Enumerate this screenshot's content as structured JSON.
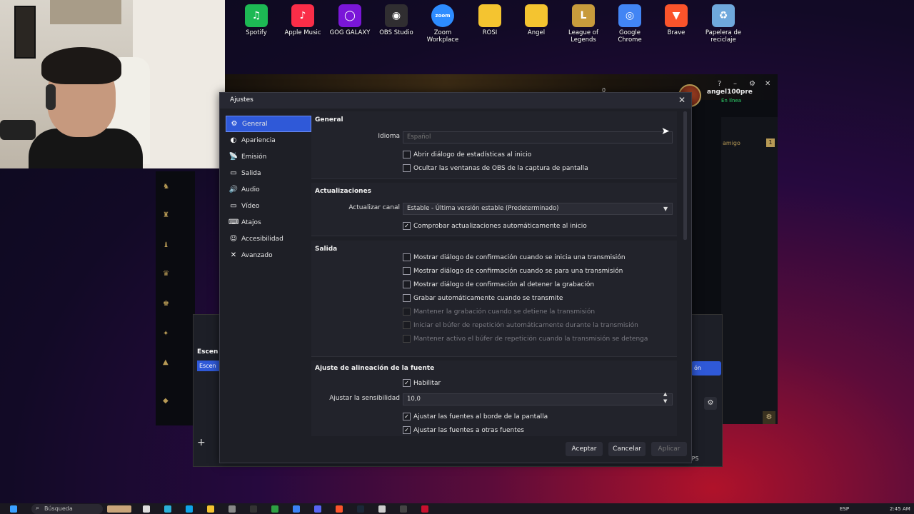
{
  "desktop": {
    "icons": [
      {
        "label": "Spotify",
        "color": "#1db954",
        "glyph": "♫"
      },
      {
        "label": "Apple Music",
        "color": "#fa2d48",
        "glyph": "♪"
      },
      {
        "label": "GOG GALAXY",
        "color": "#7a16d8",
        "glyph": "◯"
      },
      {
        "label": "OBS Studio",
        "color": "#302e31",
        "glyph": "◉"
      },
      {
        "label": "Zoom Workplace",
        "color": "#2d8cff",
        "glyph": "zoom"
      },
      {
        "label": "ROSI",
        "color": "#f4c430",
        "glyph": ""
      },
      {
        "label": "Angel",
        "color": "#f4c430",
        "glyph": ""
      },
      {
        "label": "League of Legends",
        "color": "#c89b3c",
        "glyph": "L"
      },
      {
        "label": "Google Chrome",
        "color": "#4285f4",
        "glyph": "◎"
      },
      {
        "label": "Brave",
        "color": "#fb542b",
        "glyph": "▼"
      },
      {
        "label": "Papelera de reciclaje",
        "color": "#6fa8dc",
        "glyph": "♻"
      }
    ]
  },
  "lol": {
    "username": "angel100pre",
    "status": "En línea",
    "currency": "0",
    "friend_label": "amigo",
    "friend_badge": "1"
  },
  "obs": {
    "scene_header": "Escen",
    "scene_item": "Escen",
    "fps": "FPS"
  },
  "dialog": {
    "title": "Ajustes",
    "nav": [
      {
        "label": "General",
        "icon": "gear-icon",
        "glyph": "⚙",
        "active": true
      },
      {
        "label": "Apariencia",
        "icon": "palette-icon",
        "glyph": "◐",
        "active": false
      },
      {
        "label": "Emisión",
        "icon": "broadcast-icon",
        "glyph": "📡",
        "active": false
      },
      {
        "label": "Salida",
        "icon": "output-icon",
        "glyph": "▭",
        "active": false
      },
      {
        "label": "Audio",
        "icon": "speaker-icon",
        "glyph": "🔊",
        "active": false
      },
      {
        "label": "Vídeo",
        "icon": "monitor-icon",
        "glyph": "▭",
        "active": false
      },
      {
        "label": "Atajos",
        "icon": "keyboard-icon",
        "glyph": "⌨",
        "active": false
      },
      {
        "label": "Accesibilidad",
        "icon": "accessibility-icon",
        "glyph": "☺",
        "active": false
      },
      {
        "label": "Avanzado",
        "icon": "wrench-icon",
        "glyph": "✕",
        "active": false
      }
    ],
    "general": {
      "title": "General",
      "idioma_label": "Idioma",
      "idioma_value": "Español",
      "chk_stats": "Abrir diálogo de estadísticas al inicio",
      "chk_hide": "Ocultar las ventanas de OBS de la captura de pantalla"
    },
    "updates": {
      "title": "Actualizaciones",
      "canal_label": "Actualizar canal",
      "canal_value": "Estable - Última versión estable (Predeterminado)",
      "chk_auto": "Comprobar actualizaciones automáticamente al inicio"
    },
    "output": {
      "title": "Salida",
      "items": [
        {
          "label": "Mostrar diálogo de confirmación cuando se inicia una transmisión",
          "checked": false,
          "disabled": false
        },
        {
          "label": "Mostrar diálogo de confirmación cuando se para una transmisión",
          "checked": false,
          "disabled": false
        },
        {
          "label": "Mostrar diálogo de confirmación al detener la grabación",
          "checked": false,
          "disabled": false
        },
        {
          "label": "Grabar automáticamente cuando se transmite",
          "checked": false,
          "disabled": false
        },
        {
          "label": "Mantener la grabación cuando se detiene la transmisión",
          "checked": false,
          "disabled": true
        },
        {
          "label": "Iniciar el búfer de repetición automáticamente durante la transmisión",
          "checked": false,
          "disabled": true
        },
        {
          "label": "Mantener activo el búfer de repetición cuando la transmisión se detenga",
          "checked": false,
          "disabled": true
        }
      ]
    },
    "snapping": {
      "title": "Ajuste de alineación de la fuente",
      "enable": "Habilitar",
      "sens_label": "Ajustar la sensibilidad",
      "sens_value": "10,0",
      "chk_screen": "Ajustar las fuentes al borde de la pantalla",
      "chk_other": "Ajustar las fuentes a otras fuentes"
    },
    "buttons": {
      "accept": "Aceptar",
      "cancel": "Cancelar",
      "apply": "Aplicar"
    }
  },
  "taskbar": {
    "search_placeholder": "Búsqueda",
    "lang": "ESP",
    "time": "2:45 AM"
  }
}
